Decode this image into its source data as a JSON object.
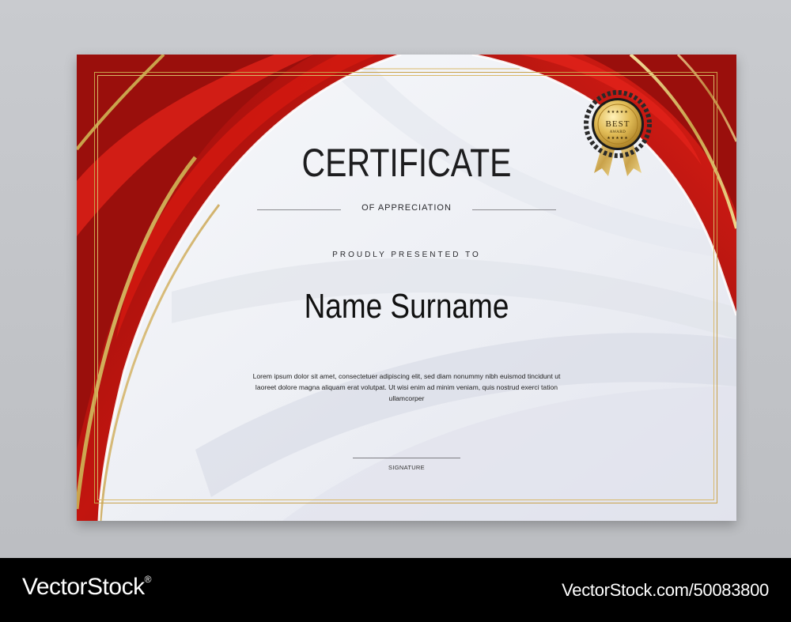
{
  "certificate": {
    "title": "CERTIFICATE",
    "subtitle": "OF APPRECIATION",
    "presented_to": "PROUDLY PRESENTED TO",
    "recipient_name": "Name Surname",
    "body_text": "Lorem ipsum dolor sit amet, consectetuer adipiscing elit, sed diam nonummy nibh euismod tincidunt ut laoreet dolore magna aliquam erat volutpat. Ut wisi enim ad minim veniam, quis nostrud exerci tation ullamcorper",
    "signature_label": "SIGNATURE",
    "badge": {
      "stars_top": "★★★★★",
      "line1": "BEST",
      "line2": "AWARD",
      "stars_bottom": "★★★★★"
    }
  },
  "footer": {
    "brand": "VectorStock",
    "registered_mark": "®",
    "image_id": "VectorStock.com/50083800"
  },
  "colors": {
    "red_dark": "#7e0d0d",
    "red": "#b4120f",
    "red_bright": "#d81e14",
    "gold": "#d9b868",
    "paper": "#f4f5f8",
    "footer_bg": "#000000"
  }
}
